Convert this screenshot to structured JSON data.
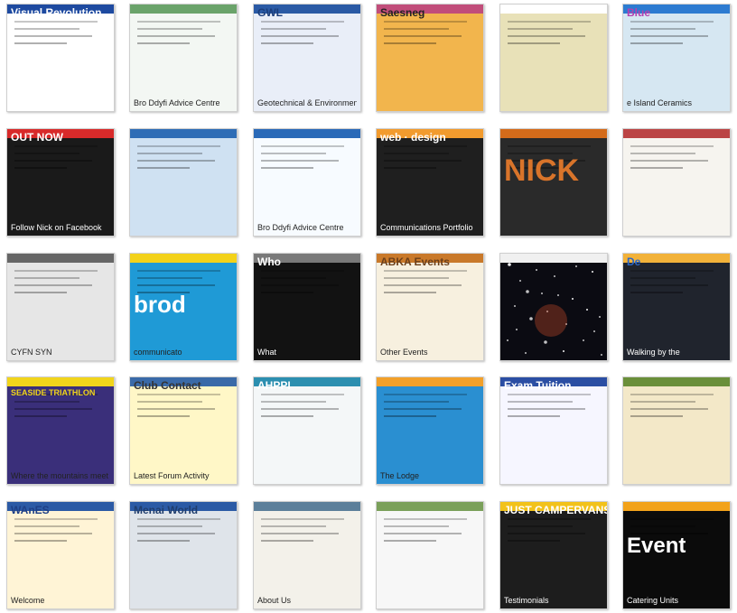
{
  "gallery": {
    "tiles": [
      {
        "id": "r1c1",
        "bg": "#ffffff",
        "accent": "#1e4aa0",
        "caption": "",
        "overlay": "Visual Revolution",
        "overlay_color": "#ffffff"
      },
      {
        "id": "r1c2",
        "bg": "#f3f7f3",
        "accent": "#6aa36a",
        "caption": "Bro Ddyfi Advice Centre",
        "overlay": "",
        "overlay_color": "#2b4d2b"
      },
      {
        "id": "r1c3",
        "bg": "#e9eef8",
        "accent": "#2a5aa5",
        "caption": "Geotechnical & Environmental Services",
        "overlay": "GWL",
        "overlay_color": "#1b3d7a"
      },
      {
        "id": "r1c4",
        "bg": "#f2b54d",
        "accent": "#c14d7a",
        "caption": "",
        "overlay": "Saesneg",
        "overlay_color": "#222222"
      },
      {
        "id": "r1c5",
        "bg": "#e8e1b8",
        "accent": "#ffffff",
        "caption": "",
        "overlay": "",
        "overlay_color": "#ffffff"
      },
      {
        "id": "r1c6",
        "bg": "#d6e7f2",
        "accent": "#2d7bd1",
        "caption": "e Island Ceramics",
        "overlay": "Blue",
        "overlay_color": "#b540b0"
      },
      {
        "id": "r2c1",
        "bg": "#1a1a1a",
        "accent": "#d82a2a",
        "caption": "Follow Nick on Facebook",
        "overlay": "OUT NOW",
        "overlay_color": "#ffffff"
      },
      {
        "id": "r2c2",
        "bg": "#cfe1f2",
        "accent": "#2f6db6",
        "caption": "",
        "overlay": "",
        "overlay_color": "#1f3d6d"
      },
      {
        "id": "r2c3",
        "bg": "#f7fbff",
        "accent": "#2a6ab8",
        "caption": "Bro Ddyfi Advice Centre",
        "overlay": "",
        "overlay_color": "#1f3d6d"
      },
      {
        "id": "r2c4",
        "bg": "#1f1f1f",
        "accent": "#f29b2e",
        "caption": "Communications Portfolio",
        "overlay": "web · design",
        "overlay_color": "#ffffff"
      },
      {
        "id": "r2c5",
        "bg": "#2a2a2a",
        "accent": "#d46b1a",
        "caption": "",
        "overlay": "NICK",
        "overlay_color": "#d9742a"
      },
      {
        "id": "r2c6",
        "bg": "#f6f4ef",
        "accent": "#b44",
        "caption": "",
        "overlay": "",
        "overlay_color": "#444444"
      },
      {
        "id": "r3c1",
        "bg": "#e6e6e6",
        "accent": "#666666",
        "caption": "CYFN  SYN",
        "overlay": "",
        "overlay_color": "#333333"
      },
      {
        "id": "r3c2",
        "bg": "#1f9ad6",
        "accent": "#f3d21a",
        "caption": "communicato",
        "overlay": "brod",
        "overlay_color": "#ffffff"
      },
      {
        "id": "r3c3",
        "bg": "#121212",
        "accent": "#7a7a7a",
        "caption": "What",
        "overlay": "Who",
        "overlay_color": "#ffffff"
      },
      {
        "id": "r3c4",
        "bg": "#f7f0df",
        "accent": "#c9792a",
        "caption": "Other Events",
        "overlay": "ABKA Events",
        "overlay_color": "#6b3f1a"
      },
      {
        "id": "r3c5",
        "bg": "#0b0b12",
        "accent": "#f0f0f0",
        "caption": "",
        "overlay": "",
        "overlay_color": "#ffffff"
      },
      {
        "id": "r3c6",
        "bg": "#20242d",
        "accent": "#f2b23a",
        "caption": "Walking by the",
        "overlay": "De",
        "overlay_color": "#2b66c6"
      },
      {
        "id": "r4c1",
        "bg": "#3a2f7a",
        "accent": "#f1d51b",
        "caption": "Where the mountains meet the sea",
        "overlay": "ABERYSTWYTH SEASIDE TRIATHLON",
        "overlay_color": "#f1d51b"
      },
      {
        "id": "r4c2",
        "bg": "#fff7c7",
        "accent": "#3a6aa8",
        "caption": "Latest Forum Activity",
        "overlay": "Club Contact",
        "overlay_color": "#333333"
      },
      {
        "id": "r4c3",
        "bg": "#f4f7f8",
        "accent": "#2c8fb0",
        "caption": "",
        "overlay": "AHPPI",
        "overlay_color": "#ffffff"
      },
      {
        "id": "r4c4",
        "bg": "#2a8fd1",
        "accent": "#f2a02a",
        "caption": "The Lodge",
        "overlay": "",
        "overlay_color": "#ffffff"
      },
      {
        "id": "r4c5",
        "bg": "#f6f6ff",
        "accent": "#2b4ea3",
        "caption": "",
        "overlay": "Exam Tuition",
        "overlay_color": "#ffffff"
      },
      {
        "id": "r4c6",
        "bg": "#f3e8c8",
        "accent": "#6a8f3a",
        "caption": "",
        "overlay": "",
        "overlay_color": "#444444"
      },
      {
        "id": "r5c1",
        "bg": "#fff4d6",
        "accent": "#2b5aa5",
        "caption": "Welcome",
        "overlay": "WAnES",
        "overlay_color": "#1e3f86"
      },
      {
        "id": "r5c2",
        "bg": "#dfe4ea",
        "accent": "#2b5aa5",
        "caption": "",
        "overlay": "Menai World",
        "overlay_color": "#1f3d6d"
      },
      {
        "id": "r5c3",
        "bg": "#f3f1ea",
        "accent": "#5c7f9a",
        "caption": "About Us",
        "overlay": "",
        "overlay_color": "#333333"
      },
      {
        "id": "r5c4",
        "bg": "#f7f7f7",
        "accent": "#7aa05a",
        "caption": "",
        "overlay": "",
        "overlay_color": "#333333"
      },
      {
        "id": "r5c5",
        "bg": "#1d1d1d",
        "accent": "#f2c21a",
        "caption": "Testimonials",
        "overlay": "JUST CAMPERVANS",
        "overlay_color": "#ffffff"
      },
      {
        "id": "r5c6",
        "bg": "#0b0b0b",
        "accent": "#f2a21a",
        "caption": "Catering Units",
        "overlay": "Event",
        "overlay_color": "#ffffff"
      }
    ]
  }
}
